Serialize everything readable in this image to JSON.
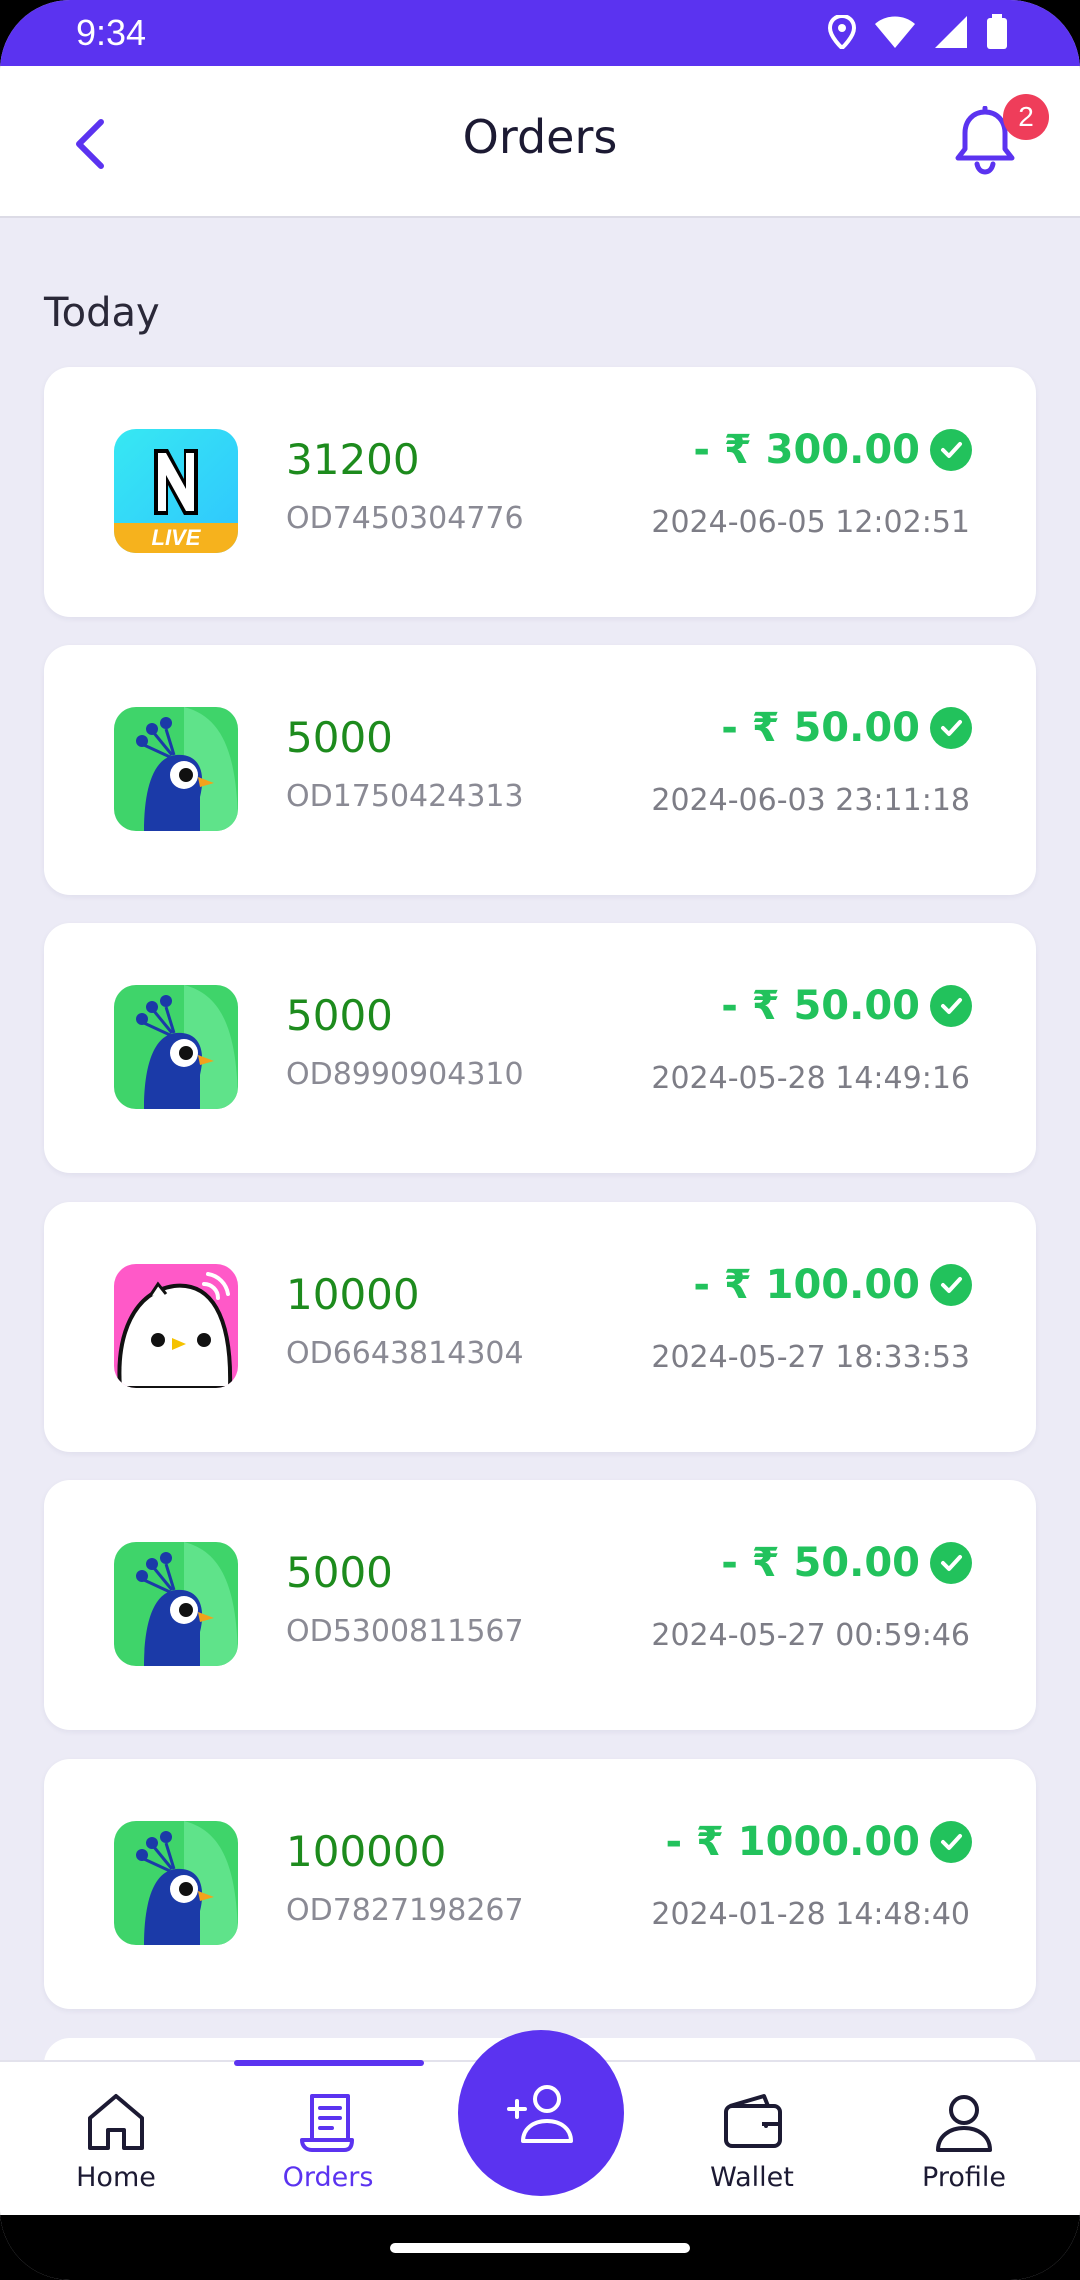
{
  "status_bar": {
    "time": "9:34"
  },
  "app_bar": {
    "title": "Orders",
    "notification_count": "2"
  },
  "section": {
    "title": "Today"
  },
  "orders": [
    {
      "logo": "n-live-app-icon",
      "coins": "31200",
      "order_id": "OD7450304776",
      "amount": "- ₹ 300.00",
      "datetime": "2024-06-05 12:02:51",
      "logo_text": "LIVE"
    },
    {
      "logo": "peacock-app-icon",
      "coins": "5000",
      "order_id": "OD1750424313",
      "amount": "- ₹ 50.00",
      "datetime": "2024-06-03 23:11:18"
    },
    {
      "logo": "peacock-app-icon",
      "coins": "5000",
      "order_id": "OD8990904310",
      "amount": "- ₹ 50.00",
      "datetime": "2024-05-28 14:49:16"
    },
    {
      "logo": "bird-app-icon",
      "coins": "10000",
      "order_id": "OD6643814304",
      "amount": "- ₹ 100.00",
      "datetime": "2024-05-27 18:33:53"
    },
    {
      "logo": "peacock-app-icon",
      "coins": "5000",
      "order_id": "OD5300811567",
      "amount": "- ₹ 50.00",
      "datetime": "2024-05-27 00:59:46"
    },
    {
      "logo": "peacock-app-icon",
      "coins": "100000",
      "order_id": "OD7827198267",
      "amount": "- ₹ 1000.00",
      "datetime": "2024-01-28 14:48:40"
    }
  ],
  "bottom_nav": {
    "home": "Home",
    "orders": "Orders",
    "wallet": "Wallet",
    "profile": "Profile"
  },
  "colors": {
    "accent": "#5b33f0",
    "coins": "#1d8b1d",
    "amount": "#22c25c",
    "badge": "#ef3d5a"
  }
}
